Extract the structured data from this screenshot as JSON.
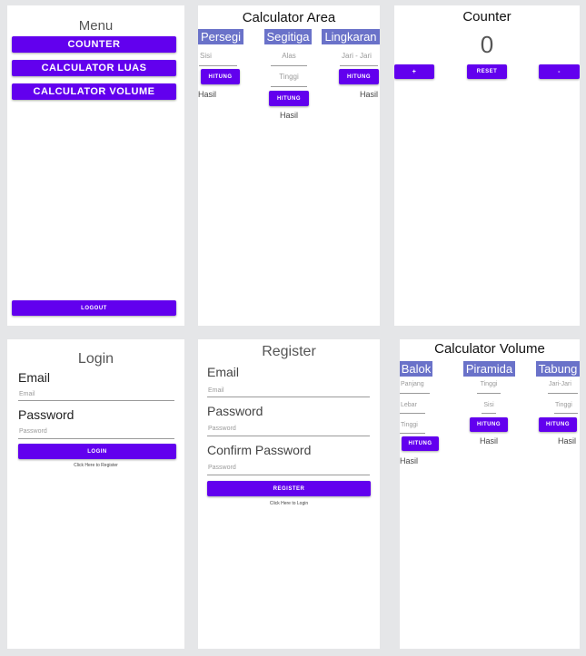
{
  "menu": {
    "title": "Menu",
    "buttons": [
      "COUNTER",
      "CALCULATOR LUAS",
      "CALCULATOR VOLUME"
    ],
    "logout": "LOGOUT"
  },
  "area": {
    "title": "Calculator Area",
    "headers": [
      "Persegi",
      "Segitiga",
      "Lingkaran"
    ],
    "persegi": {
      "hint": "Sisi",
      "button": "HITUNG",
      "result": "Hasil"
    },
    "segitiga": {
      "hint1": "Alas",
      "hint2": "Tinggi",
      "button": "HITUNG",
      "result": "Hasil"
    },
    "lingkaran": {
      "hint": "Jari - Jari",
      "button": "HITUNG",
      "result": "Hasil"
    }
  },
  "counter": {
    "title": "Counter",
    "value": "0",
    "plus": "+",
    "reset": "RESET",
    "minus": "-"
  },
  "login": {
    "title": "Login",
    "email_label": "Email",
    "email_hint": "Email",
    "password_label": "Password",
    "password_hint": "Password",
    "button": "LOGIN",
    "link": "Click Here to Register"
  },
  "register": {
    "title": "Register",
    "email_label": "Email",
    "email_hint": "Email",
    "password_label": "Password",
    "password_hint": "Password",
    "confirm_label": "Confirm Password",
    "confirm_hint": "Password",
    "button": "REGISTER",
    "link": "Click Here to Login"
  },
  "volume": {
    "title": "Calculator Volume",
    "headers": [
      "Balok",
      "Piramida",
      "Tabung"
    ],
    "balok": {
      "hint1": "Panjang",
      "hint2": "Lebar",
      "hint3": "Tinggi",
      "button": "HITUNG",
      "result": "Hasil"
    },
    "piramida": {
      "hint1": "Tinggi",
      "hint2": "Sisi",
      "button": "HITUNG",
      "result": "Hasil"
    },
    "tabung": {
      "hint1": "Jari-Jari",
      "hint2": "Tinggi",
      "button": "HITUNG",
      "result": "Hasil"
    }
  },
  "colors": {
    "primary": "#6200ee",
    "header_highlight": "#6a72c9",
    "background": "#e5e6e8"
  }
}
